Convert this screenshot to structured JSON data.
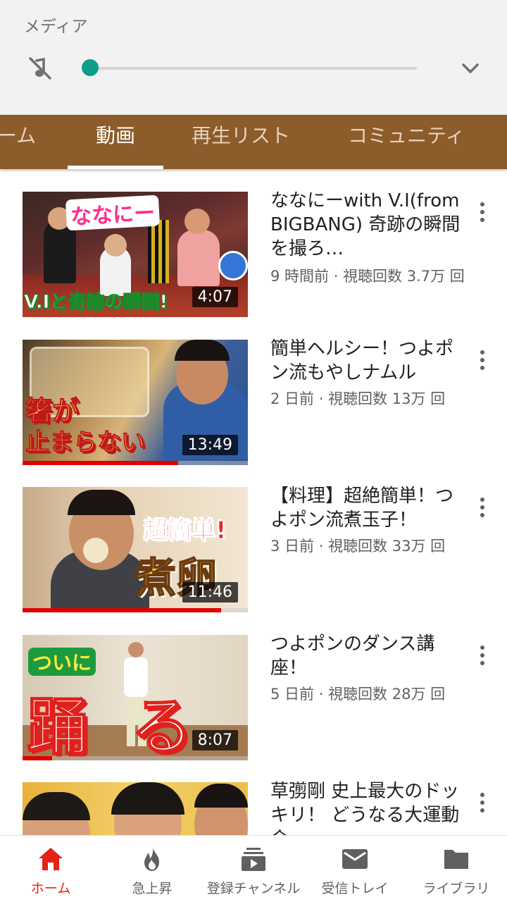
{
  "media": {
    "title": "メディア",
    "volume_level": 0,
    "icons": {
      "mute": "volume-off-icon",
      "collapse": "chevron-down-icon"
    },
    "accent_color": "#0f9d8a"
  },
  "tabs": [
    {
      "label": "ーム",
      "active": false
    },
    {
      "label": "動画",
      "active": true
    },
    {
      "label": "再生リスト",
      "active": false
    },
    {
      "label": "コミュニティ",
      "active": false
    }
  ],
  "tab_bar_color": "#8c5c2a",
  "videos": [
    {
      "title": "ななにーwith V.I(from BIGBANG) 奇跡の瞬間を撮ろ…",
      "meta": "9 時間前 · 視聴回数 3.7万 回",
      "duration": "4:07",
      "thumb_caption_top": "ななにー",
      "thumb_caption_bottom": "V.Iと奇跡の瞬間!",
      "watched": 0
    },
    {
      "title": "簡単ヘルシー！つよポン流もやしナムル",
      "meta": "2 日前 · 視聴回数 13万 回",
      "duration": "13:49",
      "thumb_caption_top": "箸が",
      "thumb_caption_bottom": "止まらない",
      "watched": 0.69
    },
    {
      "title": "【料理】超絶簡単！つよポン流煮玉子！",
      "meta": "3 日前 · 視聴回数 33万 回",
      "duration": "11:46",
      "thumb_caption_top": "超簡単!",
      "thumb_caption_bottom": "煮卵",
      "watched": 0.88
    },
    {
      "title": "つよポンのダンス講座！",
      "meta": "5 日前 · 視聴回数 28万 回",
      "duration": "8:07",
      "thumb_caption_top": "ついに",
      "thumb_caption_bottom": "踊る",
      "watched": 0.13
    },
    {
      "title": "草彅剛 史上最大のドッキリ！ どうなる大運動会…",
      "meta": "",
      "duration": "",
      "thumb_caption_top": "",
      "thumb_caption_bottom": "",
      "watched": 0
    }
  ],
  "bottom_nav": [
    {
      "label": "ホーム",
      "icon": "home-icon",
      "active": true
    },
    {
      "label": "急上昇",
      "icon": "flame-icon",
      "active": false
    },
    {
      "label": "登録チャンネル",
      "icon": "subscriptions-icon",
      "active": false
    },
    {
      "label": "受信トレイ",
      "icon": "mail-icon",
      "active": false
    },
    {
      "label": "ライブラリ",
      "icon": "folder-icon",
      "active": false
    }
  ]
}
